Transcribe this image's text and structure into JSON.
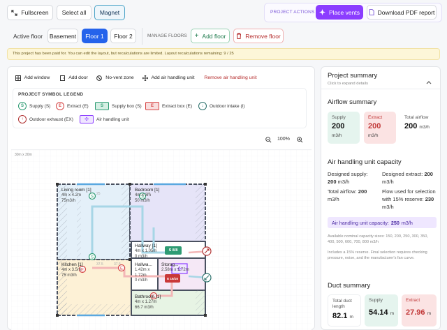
{
  "toolbar": {
    "fullscreen": "Fullscreen",
    "select_all": "Select all",
    "magnet": "Magnet",
    "project_actions": "PROJECT ACTIONS",
    "place_vents": "Place vents",
    "download_pdf": "Download PDF report"
  },
  "floors": {
    "active_label": "Active floor",
    "items": [
      "Basement",
      "Floor 1",
      "Floor 2"
    ],
    "active_index": 1,
    "manage_label": "MANAGE FLOORS",
    "add_floor": "Add floor",
    "remove_floor": "Remove floor"
  },
  "notice": "This project has been paid for. You can edit the layout, but recalculations are limited. Layout recalculations remaining: 9 / 25",
  "tools": {
    "add_window": "Add window",
    "add_door": "Add door",
    "no_vent_zone": "No-vent zone",
    "add_ahu": "Add air handling unit",
    "remove_ahu": "Remove air handling unit"
  },
  "legend": {
    "title": "PROJECT SYMBOL LEGEND",
    "items": [
      {
        "symbol": "S",
        "label": "Supply (S)"
      },
      {
        "symbol": "E",
        "label": "Extract (E)"
      },
      {
        "symbol": "S",
        "label": "Supply box (S)"
      },
      {
        "symbol": "E",
        "label": "Extract box (E)"
      },
      {
        "symbol": "↓",
        "label": "Outdoor intake (I)"
      },
      {
        "symbol": "↑",
        "label": "Outdoor exhaust (EX)"
      },
      {
        "symbol": "✣",
        "label": "Air handling unit"
      }
    ]
  },
  "zoom": {
    "value": "100%"
  },
  "canvas": {
    "dimension_label": "30m x 30m",
    "rooms": [
      {
        "name": "Living room [1]",
        "size": "4m x 4.2m",
        "flow": "75m3/h"
      },
      {
        "name": "Bedroom [1]",
        "size": "4m x 3m",
        "flow": "50 m3/h"
      },
      {
        "name": "Hallway [1]",
        "size": "4m x 1.05m",
        "flow": "0 m3/h"
      },
      {
        "name": "Kitchen [1]",
        "size": "4m x 3.5m",
        "flow": "75 m3/h"
      },
      {
        "name": "Hallwa...",
        "size": "1.42m x",
        "flow": "1.72m",
        "extra": "0 m3/h"
      },
      {
        "name": "Storag...",
        "size": "2.58m x 1.72m",
        "flow": ""
      },
      {
        "name": "Bathroom [1]",
        "size": "4m x 1.27m",
        "flow": "66.7 m3/h"
      }
    ],
    "box_supply": "S 8/8",
    "box_extract": "E 16/16",
    "vent_flows": [
      "25",
      "25",
      "37.5",
      "37.5"
    ]
  },
  "summary": {
    "title": "Project summary",
    "subtitle": "Click to expand details",
    "airflow_title": "Airflow summary",
    "supply_label": "Supply",
    "supply_value": "200",
    "extract_label": "Extract",
    "extract_value": "200",
    "total_label": "Total airflow",
    "total_value": "200",
    "unit": "m3/h",
    "ahu_title": "Air handling unit capacity",
    "designed_supply_label": "Designed supply:",
    "designed_supply_value": "200",
    "designed_extract_label": "Designed extract:",
    "designed_extract_value": "200",
    "total_airflow_label": "Total airflow:",
    "total_airflow_value": "200",
    "flow_used_text": "Flow used for selection with 15% reserve:",
    "flow_used_value": "230",
    "capacity_label": "Air handling unit capacity:",
    "capacity_value": "250",
    "nominal_note": "Available nominal capacity sizes: 150, 200, 250, 300, 350, 400, 500, 600, 700, 800 m3/h",
    "reserve_note": "Includes a 15% reserve. Final selection requires checking pressure, noise, and the manufacturer's fan curve.",
    "duct_title": "Duct summary",
    "duct_length_label": "Total duct length",
    "duct_length_value": "82.1",
    "duct_supply_label": "Supply",
    "duct_supply_value": "54.14",
    "duct_extract_label": "Extract",
    "duct_extract_value": "27.96",
    "m_unit": "m"
  },
  "colors": {
    "accent_purple": "#8b3dff",
    "floor_active": "#2563eb",
    "notice_bg": "#fdf6d8",
    "supply": "#2e9b73",
    "extract": "#d64545"
  }
}
